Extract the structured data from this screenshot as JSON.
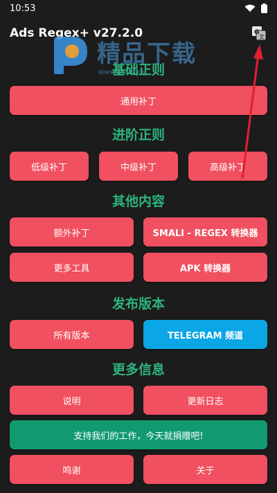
{
  "status": {
    "time": "10:53"
  },
  "app": {
    "title": "Ads Regex+ v27.2.0"
  },
  "watermark": {
    "title": "精品下载",
    "url": "www.jpp.com"
  },
  "sections": {
    "basic": "基础正则",
    "advanced": "进阶正则",
    "other": "其他内容",
    "release": "发布版本",
    "more": "更多信息"
  },
  "buttons": {
    "generic_patch": "通用补丁",
    "low_patch": "低级补丁",
    "mid_patch": "中级补丁",
    "high_patch": "高级补丁",
    "extra_patch": "额外补丁",
    "smali_converter": "SMALI - REGEX 转换器",
    "more_tools": "更多工具",
    "apk_converter": "APK 转换器",
    "all_versions": "所有版本",
    "telegram": "TELEGRAM 频道",
    "manual": "说明",
    "changelog": "更新日志",
    "donate": "支持我们的工作，今天就捐赠吧!",
    "thanks": "鸣谢",
    "about": "关于"
  },
  "colors": {
    "background": "#1c1c1c",
    "button": "#f0505f",
    "telegram": "#0aa6e6",
    "donate": "#119a70",
    "section": "#2db37d"
  }
}
